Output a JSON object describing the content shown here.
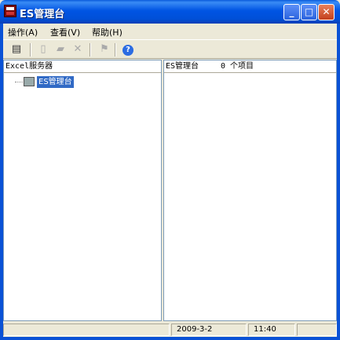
{
  "window": {
    "title": "ES管理台"
  },
  "menu": {
    "items": [
      "操作(A)",
      "查看(V)",
      "帮助(H)"
    ]
  },
  "toolbar": {
    "help_glyph": "?"
  },
  "left_pane": {
    "header": "Excel服务器",
    "tree_item": "ES管理台"
  },
  "right_pane": {
    "title": "ES管理台",
    "count": "0 个项目"
  },
  "status": {
    "date": "2009-3-2",
    "time": "11:40"
  }
}
